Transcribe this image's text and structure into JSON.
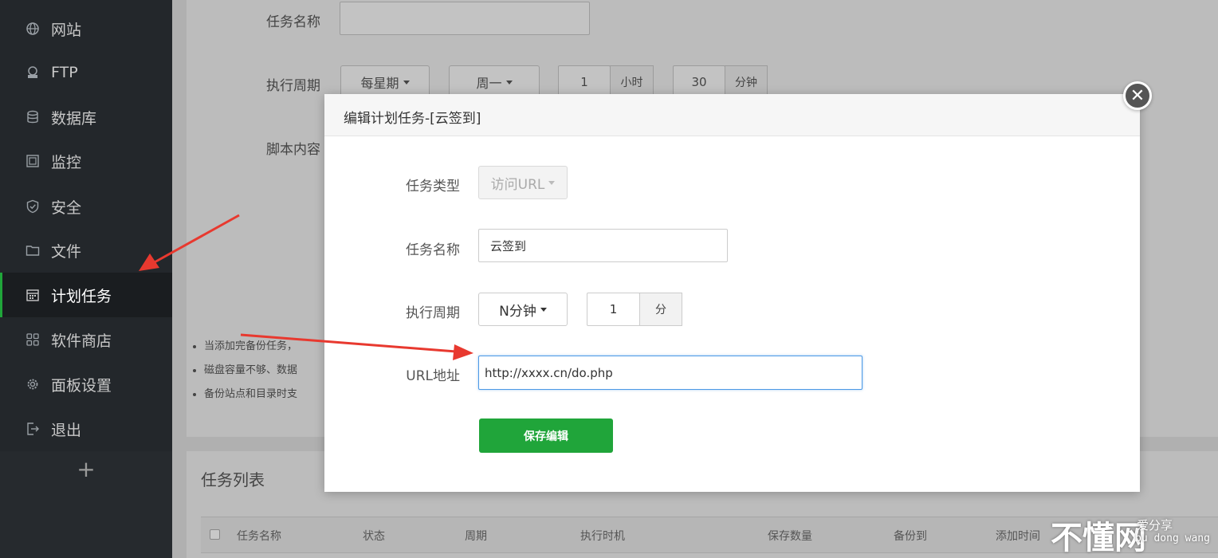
{
  "sidebar": {
    "items": [
      {
        "label": "网站",
        "icon": "globe-icon"
      },
      {
        "label": "FTP",
        "icon": "ftp-icon"
      },
      {
        "label": "数据库",
        "icon": "database-icon"
      },
      {
        "label": "监控",
        "icon": "monitor-icon"
      },
      {
        "label": "安全",
        "icon": "shield-icon"
      },
      {
        "label": "文件",
        "icon": "folder-icon"
      },
      {
        "label": "计划任务",
        "icon": "calendar-icon",
        "active": true
      },
      {
        "label": "软件商店",
        "icon": "grid-icon"
      },
      {
        "label": "面板设置",
        "icon": "gear-icon"
      },
      {
        "label": "退出",
        "icon": "logout-icon"
      }
    ],
    "add_label": "+"
  },
  "background_form": {
    "task_name_label": "任务名称",
    "period_label": "执行周期",
    "script_label": "脚本内容",
    "period_type": "每星期",
    "weekday": "周一",
    "hour_value": "1",
    "hour_unit": "小时",
    "minute_value": "30",
    "minute_unit": "分钟",
    "notes": [
      "当添加完备份任务，",
      "磁盘容量不够、数据",
      "备份站点和目录时支"
    ]
  },
  "task_list": {
    "title": "任务列表",
    "columns": [
      "任务名称",
      "状态",
      "周期",
      "执行时机",
      "保存数量",
      "备份到",
      "添加时间"
    ]
  },
  "modal": {
    "title": "编辑计划任务-[云签到]",
    "close_glyph": "✕",
    "task_type_label": "任务类型",
    "task_type_value": "访问URL",
    "task_name_label": "任务名称",
    "task_name_value": "云签到",
    "period_label": "执行周期",
    "period_type": "N分钟",
    "period_value": "1",
    "period_unit": "分",
    "url_label": "URL地址",
    "url_value": "http://xxxx.cn/do.php",
    "save_label": "保存编辑"
  },
  "watermark": {
    "big": "不懂网",
    "small1": "爱分享",
    "small2": "bu dong wang"
  },
  "colors": {
    "sidebar_bg": "#23272b",
    "accent_green": "#20a53a",
    "arrow_red": "#e8392f",
    "focus_blue": "#4c99e6"
  }
}
